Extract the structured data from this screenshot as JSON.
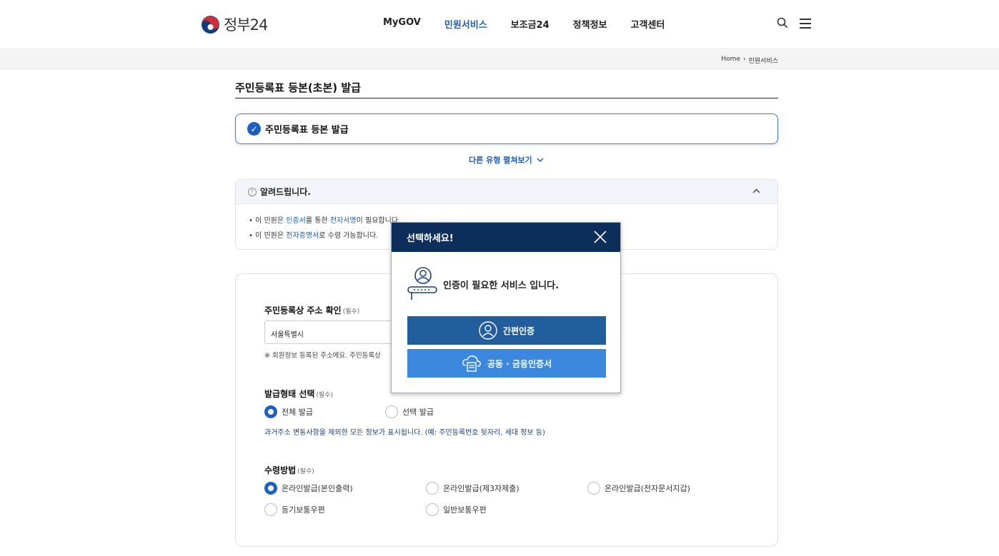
{
  "header": {
    "logo_text": "정부24",
    "nav": [
      "MyGOV",
      "민원서비스",
      "보조금24",
      "정책정보",
      "고객센터"
    ],
    "active_nav": "민원서비스"
  },
  "breadcrumb": {
    "home": "Home",
    "sep": "›",
    "current": "민원서비스"
  },
  "page": {
    "title": "주민등록표 등본(초본) 발급",
    "selected_service": "주민등록표 등본 발급",
    "more_types": "다른 유형 펼쳐보기"
  },
  "notice": {
    "title": "알려드립니다.",
    "line1": {
      "p1": "이 민원은 ",
      "h1": "인증서",
      "p2": "를 통한 ",
      "h2": "전자서명",
      "p3": "이 필요합니다."
    },
    "line2": {
      "p1": "이 민원은 ",
      "h1": "전자증명서",
      "p2": "로 수령 가능합니다."
    }
  },
  "form": {
    "address": {
      "label": "주민등록상 주소 확인",
      "required": "(필수)",
      "value": "서울특별시",
      "note": "※ 회원정보 등록된 주소에요. 주민등록상"
    },
    "issue_type": {
      "label": "발급형태 선택",
      "required": "(필수)",
      "options": [
        "전체 발급",
        "선택 발급"
      ],
      "selected": 0,
      "desc": "과거주소 변동사항을 제외한 모든 정보가 표시됩니다. (예: 주민등록번호 뒷자리, 세대 정보 등)"
    },
    "receive": {
      "label": "수령방법",
      "required": "(필수)",
      "options": [
        "온라인발급(본인출력)",
        "온라인발급(제3자제출)",
        "온라인발급(전자문서지갑)",
        "등기보통우편",
        "일반보통우편"
      ],
      "selected": 0
    }
  },
  "modal": {
    "title": "선택하세요!",
    "message": "인증이 필요한 서비스 입니다.",
    "buttons": {
      "simple": "간편인증",
      "cert": "공동 · 금융인증서"
    }
  },
  "colors": {
    "primary": "#1f5fbf",
    "modal_header": "#0d2d5a",
    "btn_simple": "#225d9e",
    "btn_cert": "#3d88df"
  }
}
